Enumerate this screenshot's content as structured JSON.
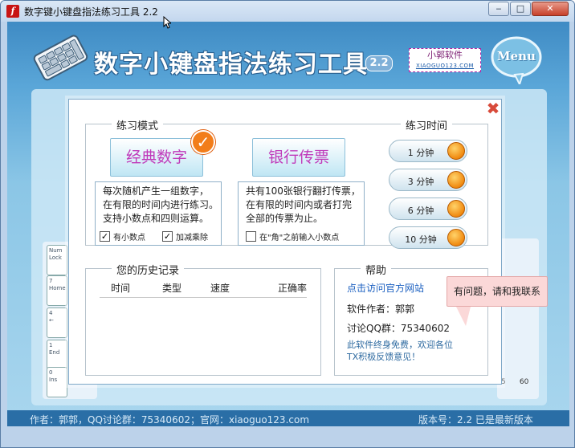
{
  "window": {
    "title": "数字键小键盘指法练习工具 2.2",
    "app_icon": "flash-icon",
    "minimize": "‒",
    "maximize": "□",
    "close": "✕"
  },
  "header": {
    "main_title": "数字小键盘指法练习工具",
    "version_badge": "2.2",
    "studio_name": "小郭软件",
    "studio_url": "XIAOGUO123.COM",
    "menu_label": "Menu"
  },
  "background": {
    "keys": [
      {
        "num": "Num",
        "sub": "Lock"
      },
      {
        "num": "7",
        "sub": "Home"
      },
      {
        "num": "4",
        "sub": "←"
      },
      {
        "num": "1",
        "sub": "End"
      },
      {
        "num": "0",
        "sub": "Ins"
      }
    ],
    "axis_ticks": [
      "5",
      "60"
    ]
  },
  "dialog": {
    "close_icon": "✖",
    "mode_group": {
      "label": "练习模式",
      "classic": {
        "label": "经典数字",
        "selected_mark": "✓",
        "desc": [
          "每次随机产生一组数字，",
          "在有限的时间内进行练习。",
          "支持小数点和四则运算。"
        ],
        "options": [
          {
            "label": "有小数点",
            "checked": true
          },
          {
            "label": "加减乘除",
            "checked": true
          }
        ]
      },
      "bank": {
        "label": "银行传票",
        "desc": [
          "共有100张银行翻打传票，",
          "在有限的时间内或者打完",
          "全部的传票为止。"
        ],
        "options": [
          {
            "label": "在\"角\"之前输入小数点",
            "checked": false
          }
        ]
      }
    },
    "time_group": {
      "label": "练习时间",
      "options": [
        "1 分钟",
        "3 分钟",
        "6 分钟",
        "10 分钟"
      ]
    },
    "history_group": {
      "label": "您的历史记录",
      "columns": [
        "时间",
        "类型",
        "速度",
        "正确率"
      ]
    },
    "help_group": {
      "label": "帮助",
      "link": "点击访问官方网站",
      "author": "软件作者：郭郭",
      "qq": "讨论QQ群：75340602",
      "note": [
        "此软件终身免费，欢迎各位",
        "TX积极反馈意见！"
      ]
    },
    "tooltip": "有问题，请和我联系"
  },
  "footer": {
    "left": "作者：郭郭，QQ讨论群：75340602；官网：xiaoguo123.com",
    "right": "版本号：2.2    已是最新版本"
  }
}
